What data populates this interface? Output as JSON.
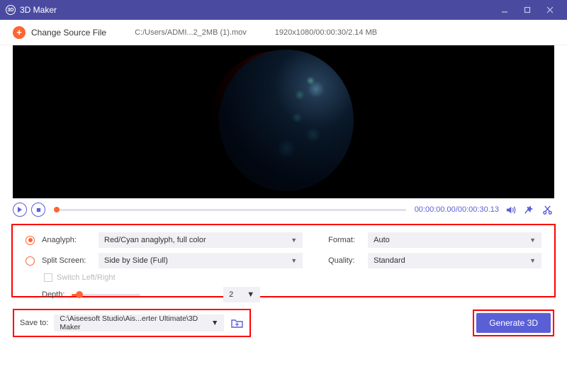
{
  "window": {
    "title": "3D Maker"
  },
  "toolbar": {
    "change_label": "Change Source File",
    "file_path": "C:/Users/ADMI...2_2MB (1).mov",
    "file_info": "1920x1080/00:00:30/2.14 MB"
  },
  "playback": {
    "time_current": "00:00:00.00",
    "time_total": "00:00:30.13"
  },
  "settings": {
    "anaglyph_label": "Anaglyph:",
    "anaglyph_value": "Red/Cyan anaglyph, full color",
    "split_label": "Split Screen:",
    "split_value": "Side by Side (Full)",
    "switch_label": "Switch Left/Right",
    "depth_label": "Depth:",
    "depth_value": "2",
    "format_label": "Format:",
    "format_value": "Auto",
    "quality_label": "Quality:",
    "quality_value": "Standard"
  },
  "footer": {
    "save_label": "Save to:",
    "save_path": "C:\\Aiseesoft Studio\\Ais...erter Ultimate\\3D Maker",
    "generate_label": "Generate 3D"
  }
}
